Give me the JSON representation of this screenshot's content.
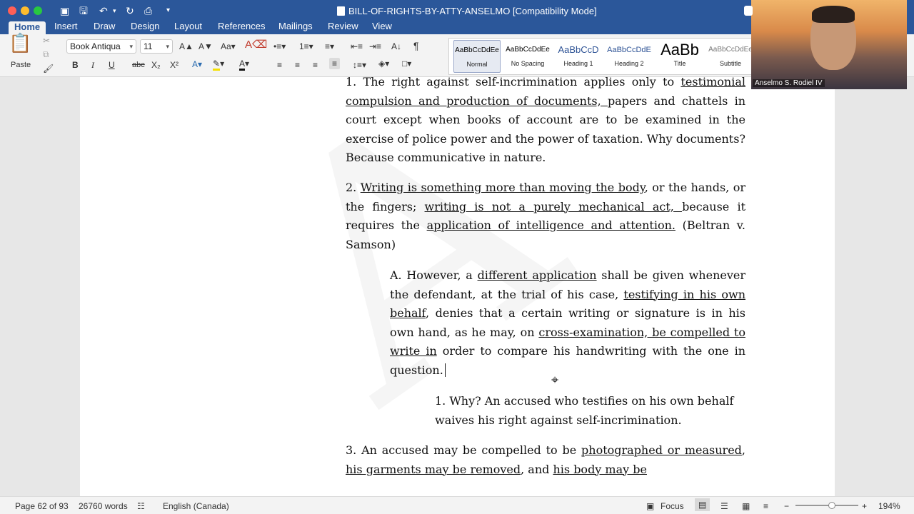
{
  "window": {
    "title": "BILL-OF-RIGHTS-BY-ATTY-ANSELMO [Compatibility Mode]"
  },
  "tabs": [
    "Home",
    "Insert",
    "Draw",
    "Design",
    "Layout",
    "References",
    "Mailings",
    "Review",
    "View"
  ],
  "ribbon": {
    "paste_label": "Paste",
    "font_name": "Book Antiqua",
    "font_size": "11",
    "styles": [
      {
        "preview": "AaBbCcDdEe",
        "label": "Normal"
      },
      {
        "preview": "AaBbCcDdEe",
        "label": "No Spacing"
      },
      {
        "preview": "AaBbCcD",
        "label": "Heading 1"
      },
      {
        "preview": "AaBbCcDdE",
        "label": "Heading 2"
      },
      {
        "preview": "AaBb",
        "label": "Title"
      },
      {
        "preview": "AaBbCcDdEe",
        "label": "Subtitle"
      }
    ]
  },
  "video": {
    "participant_name": "Anselmo S. Rodiel IV"
  },
  "document": {
    "p1": {
      "a": "1. The right against self-incrimination applies only to ",
      "b": "testimonial compulsion and production of documents, ",
      "c": "papers and chattels in court except when books of account are to be examined in the exercise of police power and the power of taxation. Why documents? Because communicative in nature."
    },
    "p2": {
      "a": "2. ",
      "b": "Writing is something more than moving the body",
      "c": ", or the hands, or the fingers; ",
      "d": "writing is not a purely mechanical act, ",
      "e": "because it requires the ",
      "f": "application of intelligence and attention.",
      "g": "  (Beltran v. Samson)"
    },
    "pA": {
      "a": "A. However, a ",
      "b": "different application",
      "c": " shall be given whenever the defendant, at the trial of his case, ",
      "d": "testifying in his own behalf",
      "e": ", denies that a certain writing or signature is in his own hand, as he may, on ",
      "f": "cross-examination, be compelled to write  in",
      "g": " order to compare his handwriting with the one in question. "
    },
    "pA1": "1. Why? An accused who testifies on his own behalf waives his right against self-incrimination.",
    "p3": {
      "a": "3. An accused may be compelled to be ",
      "b": "photographed or measured",
      "c": ", ",
      "d": "his garments may be removed",
      "e": ", and ",
      "f": "his body may be"
    }
  },
  "status": {
    "page": "Page 62 of 93",
    "words": "26760 words",
    "language": "English (Canada)",
    "focus": "Focus",
    "zoom": "194%"
  }
}
